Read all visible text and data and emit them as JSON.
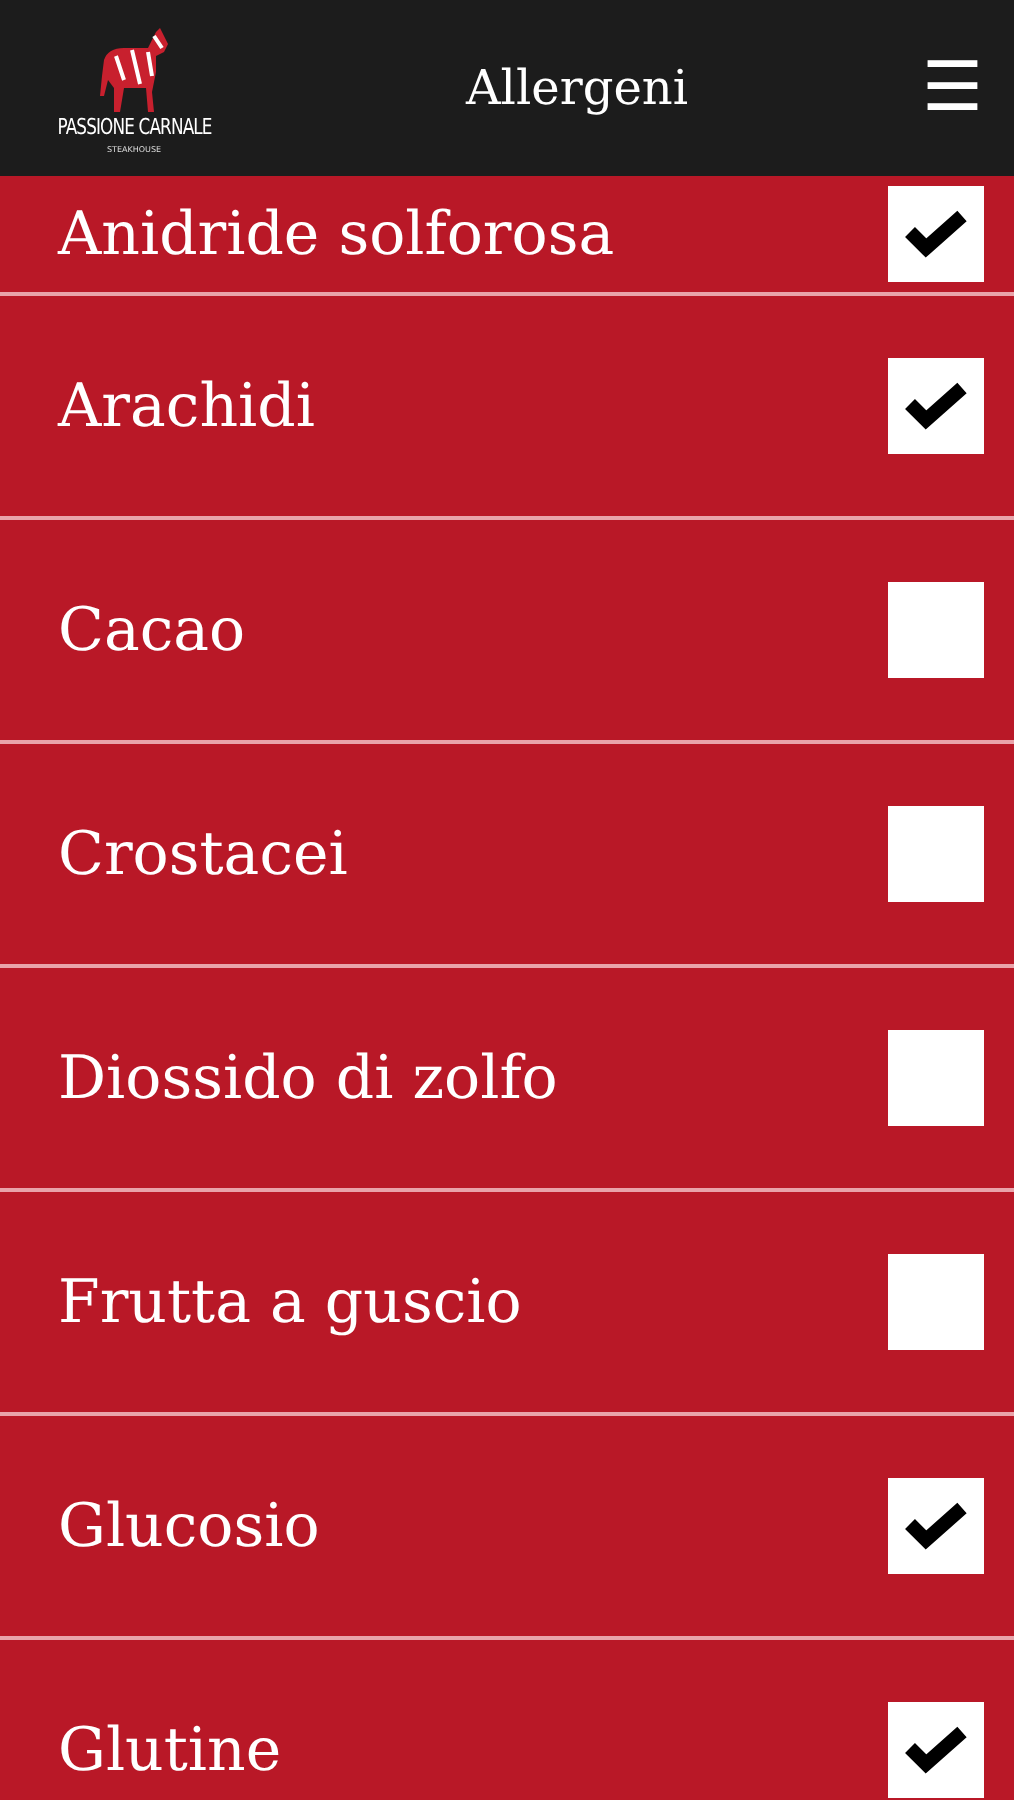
{
  "header": {
    "logo_name": "PASSIONE CARNALE",
    "logo_tagline": "STEAKHOUSE",
    "title": "Allergeni",
    "menu_icon": "☰"
  },
  "allergens": [
    {
      "name": "Anidride solforosa",
      "checked": true
    },
    {
      "name": "Arachidi",
      "checked": true
    },
    {
      "name": "Cacao",
      "checked": false
    },
    {
      "name": "Crostacei",
      "checked": false
    },
    {
      "name": "Diossido di zolfo",
      "checked": false
    },
    {
      "name": "Frutta a guscio",
      "checked": false
    },
    {
      "name": "Glucosio",
      "checked": true
    },
    {
      "name": "Glutine",
      "checked": true
    }
  ]
}
